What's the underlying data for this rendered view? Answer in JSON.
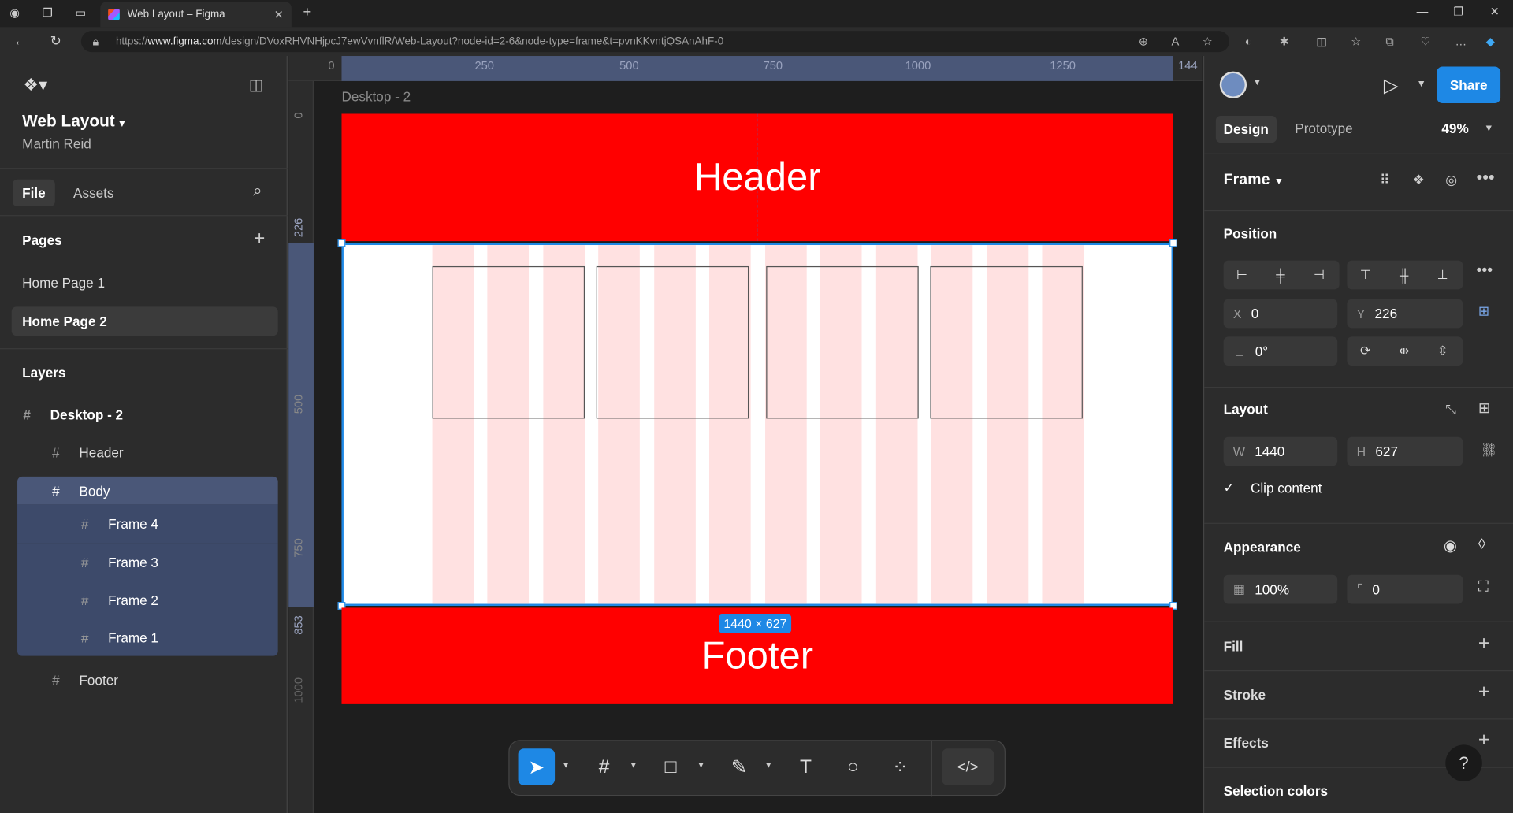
{
  "browser": {
    "tab_title": "Web Layout – Figma",
    "url_prefix": "https://",
    "url_host": "www.figma.com",
    "url_path": "/design/DVoxRHVNHjpcJ7ewVvnflR/Web-Layout?node-id=2-6&node-type=frame&t=pvnKKvntjQSAnAhF-0"
  },
  "file": {
    "title": "Web Layout",
    "owner": "Martin Reid"
  },
  "left_tabs": {
    "file": "File",
    "assets": "Assets"
  },
  "pages": {
    "heading": "Pages",
    "items": [
      "Home Page 1",
      "Home Page 2"
    ]
  },
  "layers": {
    "heading": "Layers",
    "items": [
      {
        "label": "Desktop - 2"
      },
      {
        "label": "Header"
      },
      {
        "label": "Body"
      },
      {
        "label": "Frame 4"
      },
      {
        "label": "Frame 3"
      },
      {
        "label": "Frame 2"
      },
      {
        "label": "Frame 1"
      },
      {
        "label": "Footer"
      }
    ]
  },
  "canvas": {
    "frame_label": "Desktop - 2",
    "header_text": "Header",
    "footer_text": "Footer",
    "dimension_badge": "1440 × 627",
    "ruler_top": [
      "0",
      "250",
      "500",
      "750",
      "1000",
      "1250",
      "144"
    ],
    "ruler_left": [
      "0",
      "226",
      "500",
      "750",
      "853",
      "1000"
    ]
  },
  "right": {
    "share_label": "Share",
    "tab_design": "Design",
    "tab_prototype": "Prototype",
    "zoom": "49%",
    "frame_type": "Frame",
    "position_heading": "Position",
    "x_label": "X",
    "x_value": "0",
    "y_label": "Y",
    "y_value": "226",
    "rotation": "0°",
    "layout_heading": "Layout",
    "w_label": "W",
    "w_value": "1440",
    "h_label": "H",
    "h_value": "627",
    "clip_content": "Clip content",
    "appearance_heading": "Appearance",
    "opacity": "100%",
    "radius": "0",
    "fill_heading": "Fill",
    "stroke_heading": "Stroke",
    "effects_heading": "Effects",
    "selection_colors_heading": "Selection colors"
  },
  "colors": {
    "accent": "#1e88e5",
    "frame_red": "#ff0000",
    "column_pink": "#ffe1e1",
    "selection": "#4a5778"
  }
}
